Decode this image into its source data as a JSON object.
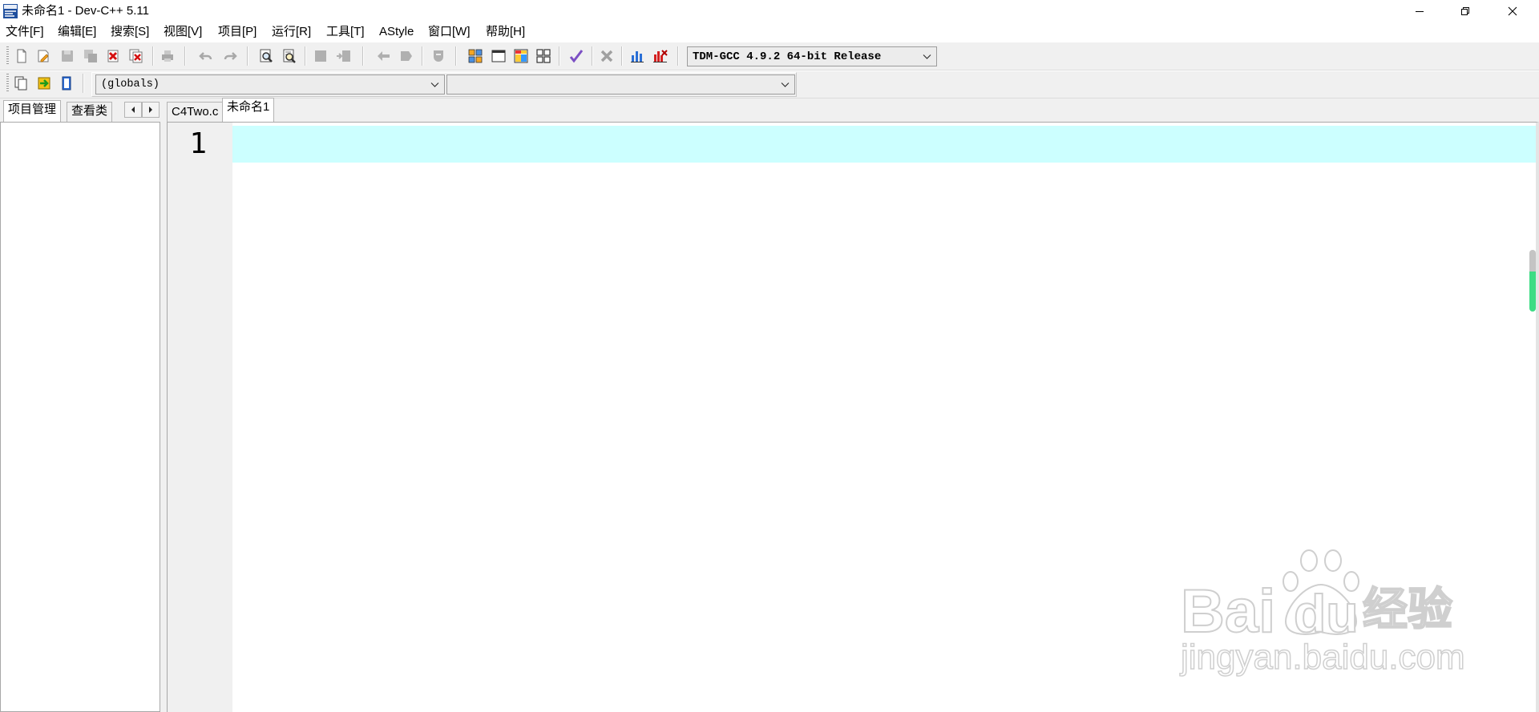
{
  "window": {
    "title": "未命名1 - Dev-C++ 5.11",
    "app_icon": "devcpp-app-icon",
    "control_icons": [
      "minimize-icon",
      "restore-icon",
      "close-icon"
    ]
  },
  "menu": {
    "items": [
      "文件[F]",
      "编辑[E]",
      "搜索[S]",
      "视图[V]",
      "项目[P]",
      "运行[R]",
      "工具[T]",
      "AStyle",
      "窗口[W]",
      "帮助[H]"
    ]
  },
  "toolbar": {
    "icons": [
      {
        "name": "new-file-icon",
        "enabled": true
      },
      {
        "name": "open-file-icon",
        "enabled": true
      },
      {
        "name": "save-icon",
        "enabled": false
      },
      {
        "name": "save-all-icon",
        "enabled": false
      },
      {
        "name": "close-file-icon",
        "enabled": true
      },
      {
        "name": "close-all-icon",
        "enabled": true
      },
      {
        "name": "print-icon",
        "enabled": false
      },
      {
        "name": "undo-icon",
        "enabled": false
      },
      {
        "name": "redo-icon",
        "enabled": false
      },
      {
        "name": "find-icon",
        "enabled": true
      },
      {
        "name": "replace-icon",
        "enabled": true
      },
      {
        "name": "add-to-project-icon",
        "enabled": false
      },
      {
        "name": "remove-from-project-icon",
        "enabled": false
      },
      {
        "name": "indent-icon",
        "enabled": false
      },
      {
        "name": "unindent-icon",
        "enabled": false
      },
      {
        "name": "toggle-comment-icon",
        "enabled": false
      },
      {
        "name": "compile-icon",
        "enabled": true
      },
      {
        "name": "run-icon",
        "enabled": true
      },
      {
        "name": "compile-run-icon",
        "enabled": true
      },
      {
        "name": "rebuild-all-icon",
        "enabled": true
      },
      {
        "name": "syntax-check-icon",
        "enabled": true
      },
      {
        "name": "stop-execution-icon",
        "enabled": false
      },
      {
        "name": "profile-analysis-icon",
        "enabled": true
      },
      {
        "name": "delete-profile-icon",
        "enabled": true
      }
    ],
    "compiler_set": "TDM-GCC 4.9.2 64-bit Release"
  },
  "class_toolbar": {
    "icons": [
      {
        "name": "insert-icon",
        "enabled": true
      },
      {
        "name": "toggle-bookmark-icon",
        "enabled": true
      },
      {
        "name": "goto-bookmark-icon",
        "enabled": true
      }
    ],
    "scope": "(globals)"
  },
  "left_panel": {
    "tabs": [
      {
        "label": "项目管理",
        "active": true
      },
      {
        "label": "查看类",
        "active": false
      }
    ],
    "nav_icons": [
      "scroll-left-icon",
      "scroll-right-icon"
    ]
  },
  "editor": {
    "tabs": [
      {
        "label": "C4Two.c",
        "active": false
      },
      {
        "label": "未命名1",
        "active": true
      }
    ],
    "line_numbers": [
      "1"
    ]
  },
  "colors": {
    "current_line_highlight": "#CCFFFF",
    "gutter_background": "#F0F0F0",
    "toolbar_background": "#F0F0F0",
    "scroll_marker": "#3DDC84"
  },
  "watermark": {
    "logo_left": "Bai",
    "logo_right": "du",
    "logo_cn": "经验",
    "url": "jingyan.baidu.com"
  }
}
